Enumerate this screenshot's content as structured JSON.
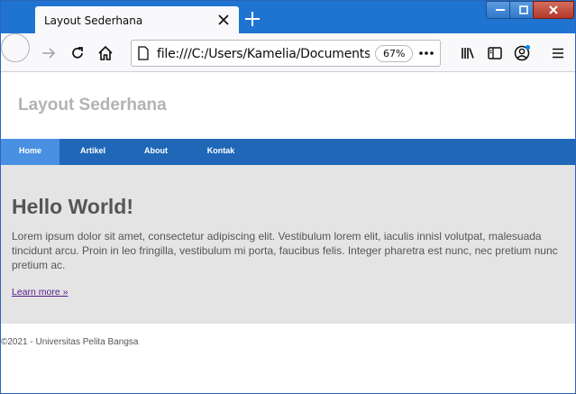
{
  "browser": {
    "tab_title": "Layout Sederhana",
    "url": "file:///C:/Users/Kamelia/Documents/KULIAH",
    "zoom": "67%",
    "icons": {
      "tab_close": "close-icon",
      "new_tab": "plus-icon",
      "back": "arrow-left-icon",
      "forward": "arrow-right-icon",
      "reload": "reload-icon",
      "home": "home-icon",
      "page": "page-icon",
      "more": "ellipsis-icon",
      "library": "library-icon",
      "sidebar": "sidebar-icon",
      "account": "account-icon",
      "menu": "hamburger-menu-icon"
    },
    "colors": {
      "titlebar": "#1f74d1",
      "toolbar": "#f9f9fb"
    }
  },
  "site": {
    "title": "Layout Sederhana",
    "nav": [
      {
        "label": "Home",
        "active": true
      },
      {
        "label": "Artikel",
        "active": false
      },
      {
        "label": "About",
        "active": false
      },
      {
        "label": "Kontak",
        "active": false
      }
    ],
    "hero": {
      "heading": "Hello World!",
      "text": "Lorem ipsum dolor sit amet, consectetur adipiscing elit. Vestibulum lorem elit, iaculis innisl volutpat, malesuada tincidunt arcu. Proin in leo fringilla, vestibulum mi porta, faucibus felis. Integer pharetra est nunc, nec pretium nunc pretium ac.",
      "link": "Learn more »"
    },
    "footer": "©2021 - Universitas Pelita Bangsa",
    "colors": {
      "nav": "#2067b8",
      "nav_active": "#4a90e2",
      "hero_bg": "#e4e4e4",
      "title": "#b3b3b3",
      "text": "#555555"
    }
  }
}
